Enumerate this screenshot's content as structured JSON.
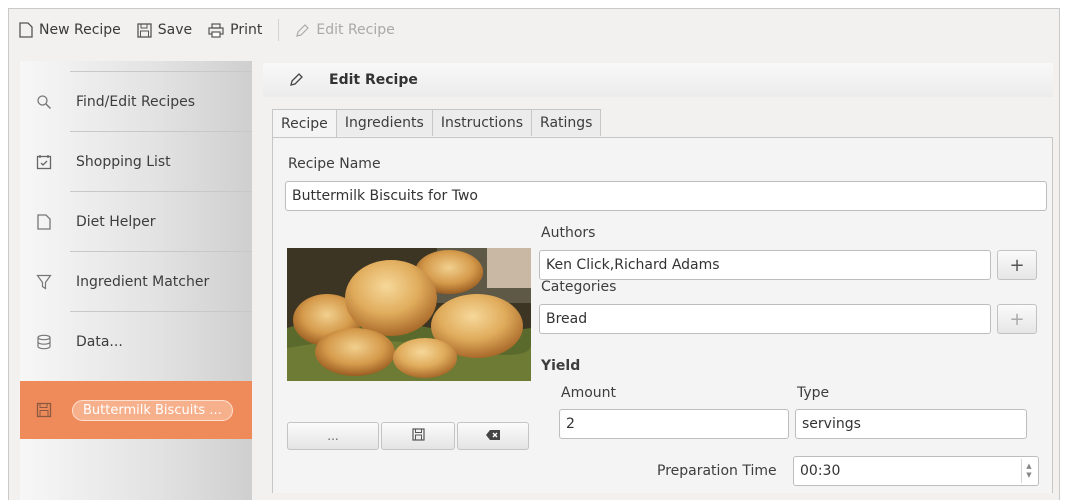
{
  "toolbar": {
    "new_recipe": "New Recipe",
    "save": "Save",
    "print": "Print",
    "edit_recipe": "Edit Recipe"
  },
  "sidebar": {
    "items": [
      {
        "label": "Find/Edit Recipes",
        "icon": "search-icon"
      },
      {
        "label": "Shopping List",
        "icon": "shopping-list-icon"
      },
      {
        "label": "Diet Helper",
        "icon": "document-icon"
      },
      {
        "label": "Ingredient Matcher",
        "icon": "filter-icon"
      },
      {
        "label": "Data...",
        "icon": "database-icon"
      },
      {
        "label": "Buttermilk Biscuits ...",
        "icon": "save-icon",
        "active": true
      }
    ]
  },
  "edit_header": {
    "title": "Edit Recipe"
  },
  "tabs": [
    "Recipe",
    "Ingredients",
    "Instructions",
    "Ratings"
  ],
  "form": {
    "recipe_name_label": "Recipe Name",
    "recipe_name_value": "Buttermilk Biscuits for Two",
    "authors_label": "Authors",
    "authors_value": "Ken Click,Richard Adams",
    "categories_label": "Categories",
    "categories_value": "Bread",
    "yield_label": "Yield",
    "amount_label": "Amount",
    "amount_value": "2",
    "type_label": "Type",
    "type_value": "servings",
    "prep_time_label": "Preparation Time",
    "prep_time_value": "00:30",
    "plus": "+",
    "image_browse": "...",
    "image_save_icon": "save-icon",
    "image_delete_icon": "delete-icon"
  },
  "colors": {
    "active_item": "#ef8a5a",
    "active_pill": "#f7b08c"
  }
}
